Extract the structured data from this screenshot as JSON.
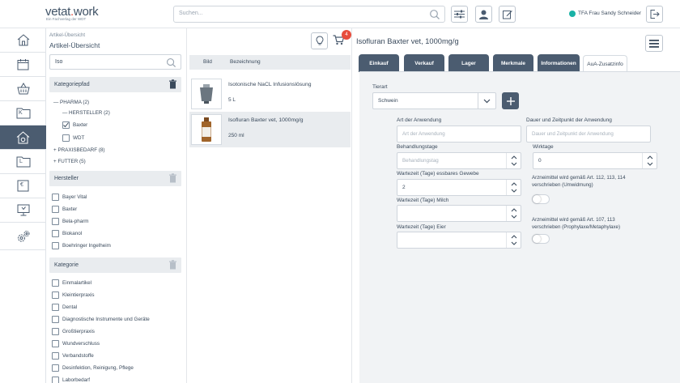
{
  "header": {
    "logo": "vetat",
    "logo_dot": ".",
    "logo_rest": "work",
    "logo_sub": "Ein Fachverlag der WDT",
    "search_placeholder": "Suchen...",
    "user_name": "TFA Frau Sandy Schneider",
    "status_color": "#1ab2a6"
  },
  "nav": {
    "items": [
      {
        "icon": "home-icon"
      },
      {
        "icon": "calendar-icon"
      },
      {
        "icon": "basket-icon"
      },
      {
        "icon": "folder-k-icon",
        "letter": "K"
      },
      {
        "icon": "house-gear-icon",
        "active": true
      },
      {
        "icon": "folder-l-icon",
        "letter": "L"
      },
      {
        "icon": "euro-icon",
        "letter": "€"
      },
      {
        "icon": "monitor-icon"
      },
      {
        "icon": "gears-icon"
      }
    ]
  },
  "overview": {
    "breadcrumb": "Artikel-Übersicht",
    "title": "Artikel-Übersicht",
    "filter_value": "Iso",
    "categories_header": "Kategoriepfad",
    "tree": [
      {
        "prefix": "—",
        "label": "PHARMA (2)"
      },
      {
        "prefix": "—",
        "label": "HERSTELLER (2)"
      },
      {
        "label": "Baxter",
        "checked": true
      },
      {
        "label": "WDT",
        "checked": false
      },
      {
        "prefix": "+",
        "label": "PRAXISBEDARF (8)"
      },
      {
        "prefix": "+",
        "label": "FUTTER (5)"
      }
    ],
    "manufacturer_header": "Hersteller",
    "manufacturers": [
      "Bayer Vital",
      "Baxter",
      "Bela-pharm",
      "Biokanol",
      "Boehringer Ingelheim"
    ],
    "category_header": "Kategorie",
    "categories": [
      "Einmalartikel",
      "Kleintierpraxis",
      "Dental",
      "Diagnostische Instrumente und Geräte",
      "Großtierpraxis",
      "Wundverschluss",
      "Verbandstoffe",
      "Desinfektion, Reinigung, Pflege",
      "Laborbedarf"
    ]
  },
  "list": {
    "cart_count": "4",
    "col_image": "Bild",
    "col_name": "Bezeichnung",
    "rows": [
      {
        "name": "Isotonische NaCL Infusionslösung",
        "size": "5 L"
      },
      {
        "name": "Isofluran Baxter vet, 1000mg/g",
        "size": "250 ml"
      }
    ]
  },
  "detail": {
    "title": "Isofluran Baxter vet, 1000mg/g",
    "tabs": [
      "Einkauf",
      "Verkauf",
      "Lager",
      "Merkmale",
      "Informationen",
      "AuA-Zusatzinfo"
    ],
    "species_label": "Tierart",
    "species_value": "Schwein",
    "application_label": "Art der Anwendung",
    "application_placeholder": "Art der Anwendung",
    "duration_label": "Dauer und Zeitpunkt der Anwendung",
    "duration_placeholder": "Dauer und Zeitpunkt der Anwendung",
    "treatment_days_label": "Behandlungstage",
    "treatment_days_placeholder": "Behandlungstag",
    "effect_days_label": "Wirktage",
    "effect_days_value": "0",
    "withdrawal_meat_label": "Wartezeit (Tage) essbares Gewebe",
    "withdrawal_meat_value": "2",
    "withdrawal_milk_label": "Wartezeit (Tage) Milch",
    "withdrawal_eggs_label": "Wartezeit (Tage) Eier",
    "note_1_line1": "Arzneimittel wird gemäß Art. 112, 113, 114",
    "note_1_line2": "verschrieben (Umwidmung)",
    "note_2_line1": "Arzneimittel wird gemäß Art. 107, 113",
    "note_2_line2": "verschrieben (Prophylaxe/Metaphylaxe)"
  },
  "colors": {
    "primary": "#4b5c70",
    "accent_red": "#e74c3c",
    "panel_bg": "#f1f3f5"
  }
}
